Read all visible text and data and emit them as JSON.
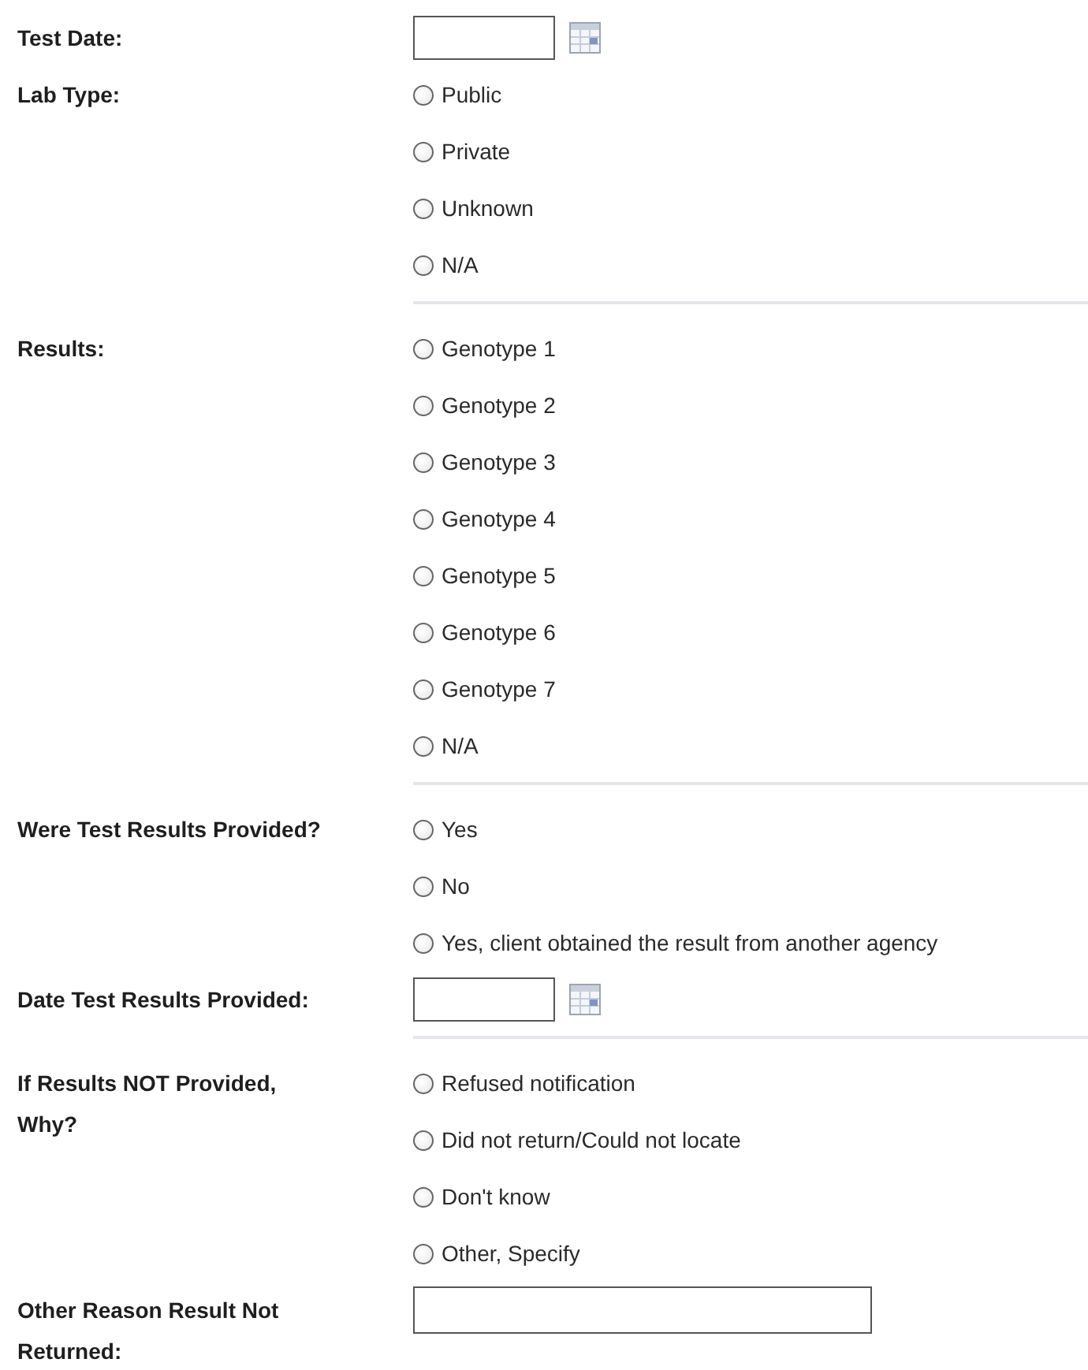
{
  "groups": [
    [
      {
        "kind": "date",
        "label": "Test Date:"
      },
      {
        "kind": "radio",
        "label": "Lab Type:",
        "options": [
          {
            "label": "Public",
            "selected": false
          },
          {
            "label": "Private",
            "selected": false
          },
          {
            "label": "Unknown",
            "selected": false
          },
          {
            "label": "N/A",
            "selected": false
          }
        ]
      }
    ],
    [
      {
        "kind": "radio",
        "label": "Results:",
        "options": [
          {
            "label": "Genotype 1",
            "selected": false
          },
          {
            "label": "Genotype 2",
            "selected": false
          },
          {
            "label": "Genotype 3",
            "selected": false
          },
          {
            "label": "Genotype 4",
            "selected": false
          },
          {
            "label": "Genotype 5",
            "selected": false
          },
          {
            "label": "Genotype 6",
            "selected": false
          },
          {
            "label": "Genotype 7",
            "selected": false
          },
          {
            "label": "N/A",
            "selected": false
          }
        ]
      }
    ],
    [
      {
        "kind": "radio",
        "label": "Were Test Results Provided?",
        "options": [
          {
            "label": "Yes",
            "selected": false
          },
          {
            "label": "No",
            "selected": false
          },
          {
            "label": "Yes, client obtained the result from another agency",
            "selected": false
          }
        ]
      },
      {
        "kind": "date",
        "label": "Date Test Results Provided:"
      }
    ],
    [
      {
        "kind": "radio",
        "label": "If Results NOT Provided,\nWhy?",
        "options": [
          {
            "label": "Refused notification",
            "selected": false
          },
          {
            "label": "Did not return/Could not locate",
            "selected": false
          },
          {
            "label": "Don't know",
            "selected": false
          },
          {
            "label": "Other, Specify",
            "selected": false
          }
        ]
      },
      {
        "kind": "text",
        "label": "Other Reason Result Not\nReturned:"
      }
    ]
  ]
}
